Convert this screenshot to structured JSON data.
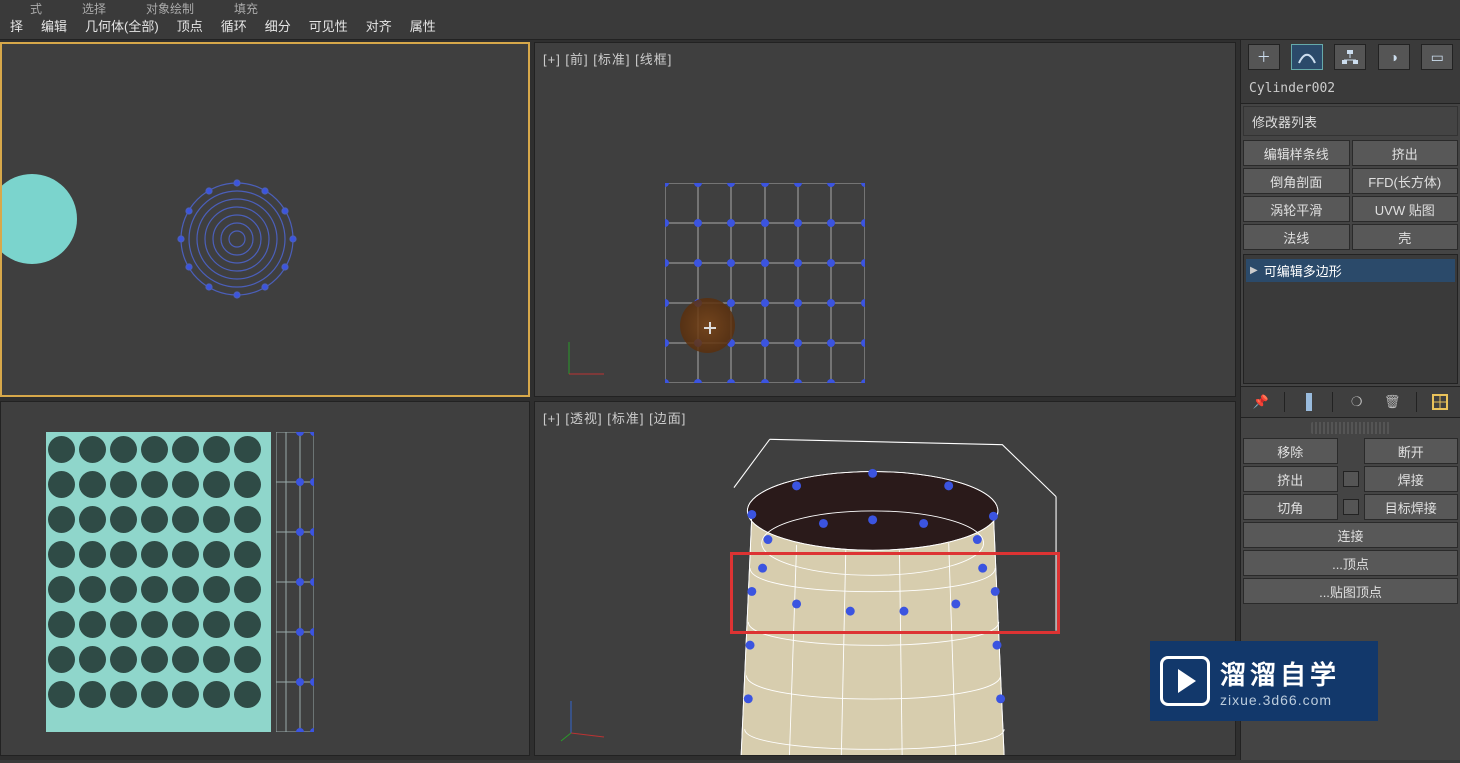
{
  "topStrip1": {
    "a": "式",
    "b": "选择",
    "c": "对象绘制",
    "d": "填充"
  },
  "menu": {
    "m0": "择",
    "m1": "编辑",
    "m2": "几何体(全部)",
    "m3": "顶点",
    "m4": "循环",
    "m5": "细分",
    "m6": "可见性",
    "m7": "对齐",
    "m8": "属性"
  },
  "viewports": {
    "tl_label": "",
    "tr_label": "[+] [前] [标准] [线框]",
    "bl_label": "",
    "br_label": "[+] [透视] [标准] [边面]"
  },
  "panel": {
    "objectName": "Cylinder002",
    "modListLabel": "修改器列表",
    "buttons": {
      "b0": "编辑样条线",
      "b1": "挤出",
      "b2": "倒角剖面",
      "b3": "FFD(长方体)",
      "b4": "涡轮平滑",
      "b5": "UVW 贴图",
      "b6": "法线",
      "b7": "壳"
    },
    "stackItem": "可编辑多边形",
    "ops": {
      "r0a": "移除",
      "r0b": "断开",
      "r1a": "挤出",
      "r1b": "焊接",
      "r2a": "切角",
      "r2b": "目标焊接",
      "r3": "连接",
      "r4": "...顶点",
      "r5": "...贴图顶点"
    }
  },
  "watermark": {
    "line1": "溜溜自学",
    "line2": "zixue.3d66.com"
  }
}
